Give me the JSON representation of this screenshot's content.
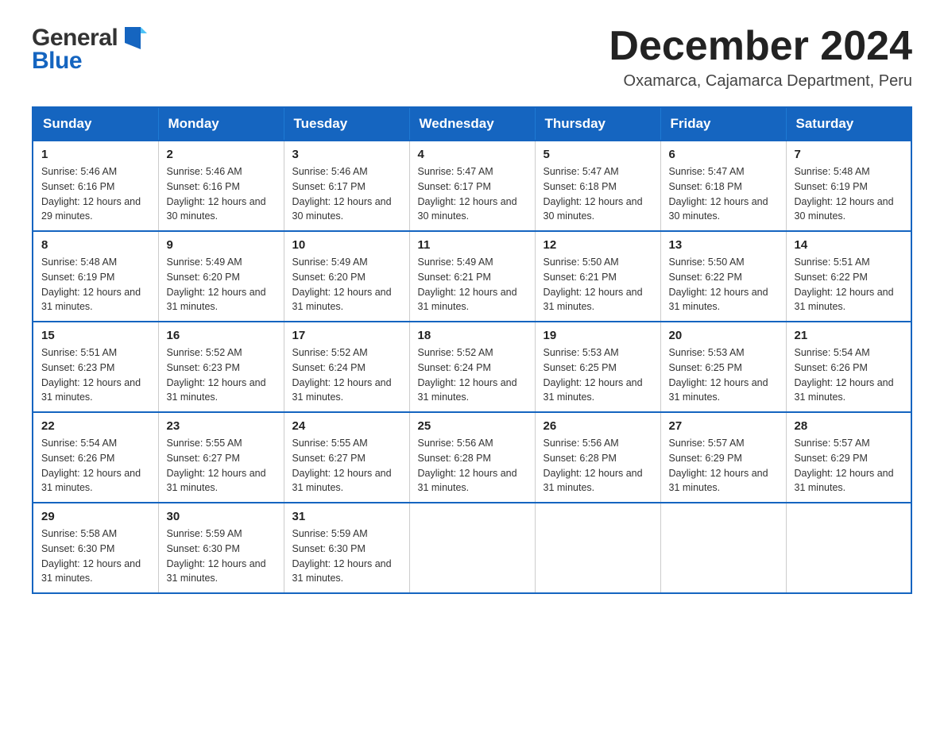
{
  "logo": {
    "part1": "General",
    "part2": "Blue"
  },
  "header": {
    "title": "December 2024",
    "subtitle": "Oxamarca, Cajamarca Department, Peru"
  },
  "days_of_week": [
    "Sunday",
    "Monday",
    "Tuesday",
    "Wednesday",
    "Thursday",
    "Friday",
    "Saturday"
  ],
  "weeks": [
    [
      {
        "day": "1",
        "sunrise": "Sunrise: 5:46 AM",
        "sunset": "Sunset: 6:16 PM",
        "daylight": "Daylight: 12 hours and 29 minutes."
      },
      {
        "day": "2",
        "sunrise": "Sunrise: 5:46 AM",
        "sunset": "Sunset: 6:16 PM",
        "daylight": "Daylight: 12 hours and 30 minutes."
      },
      {
        "day": "3",
        "sunrise": "Sunrise: 5:46 AM",
        "sunset": "Sunset: 6:17 PM",
        "daylight": "Daylight: 12 hours and 30 minutes."
      },
      {
        "day": "4",
        "sunrise": "Sunrise: 5:47 AM",
        "sunset": "Sunset: 6:17 PM",
        "daylight": "Daylight: 12 hours and 30 minutes."
      },
      {
        "day": "5",
        "sunrise": "Sunrise: 5:47 AM",
        "sunset": "Sunset: 6:18 PM",
        "daylight": "Daylight: 12 hours and 30 minutes."
      },
      {
        "day": "6",
        "sunrise": "Sunrise: 5:47 AM",
        "sunset": "Sunset: 6:18 PM",
        "daylight": "Daylight: 12 hours and 30 minutes."
      },
      {
        "day": "7",
        "sunrise": "Sunrise: 5:48 AM",
        "sunset": "Sunset: 6:19 PM",
        "daylight": "Daylight: 12 hours and 30 minutes."
      }
    ],
    [
      {
        "day": "8",
        "sunrise": "Sunrise: 5:48 AM",
        "sunset": "Sunset: 6:19 PM",
        "daylight": "Daylight: 12 hours and 31 minutes."
      },
      {
        "day": "9",
        "sunrise": "Sunrise: 5:49 AM",
        "sunset": "Sunset: 6:20 PM",
        "daylight": "Daylight: 12 hours and 31 minutes."
      },
      {
        "day": "10",
        "sunrise": "Sunrise: 5:49 AM",
        "sunset": "Sunset: 6:20 PM",
        "daylight": "Daylight: 12 hours and 31 minutes."
      },
      {
        "day": "11",
        "sunrise": "Sunrise: 5:49 AM",
        "sunset": "Sunset: 6:21 PM",
        "daylight": "Daylight: 12 hours and 31 minutes."
      },
      {
        "day": "12",
        "sunrise": "Sunrise: 5:50 AM",
        "sunset": "Sunset: 6:21 PM",
        "daylight": "Daylight: 12 hours and 31 minutes."
      },
      {
        "day": "13",
        "sunrise": "Sunrise: 5:50 AM",
        "sunset": "Sunset: 6:22 PM",
        "daylight": "Daylight: 12 hours and 31 minutes."
      },
      {
        "day": "14",
        "sunrise": "Sunrise: 5:51 AM",
        "sunset": "Sunset: 6:22 PM",
        "daylight": "Daylight: 12 hours and 31 minutes."
      }
    ],
    [
      {
        "day": "15",
        "sunrise": "Sunrise: 5:51 AM",
        "sunset": "Sunset: 6:23 PM",
        "daylight": "Daylight: 12 hours and 31 minutes."
      },
      {
        "day": "16",
        "sunrise": "Sunrise: 5:52 AM",
        "sunset": "Sunset: 6:23 PM",
        "daylight": "Daylight: 12 hours and 31 minutes."
      },
      {
        "day": "17",
        "sunrise": "Sunrise: 5:52 AM",
        "sunset": "Sunset: 6:24 PM",
        "daylight": "Daylight: 12 hours and 31 minutes."
      },
      {
        "day": "18",
        "sunrise": "Sunrise: 5:52 AM",
        "sunset": "Sunset: 6:24 PM",
        "daylight": "Daylight: 12 hours and 31 minutes."
      },
      {
        "day": "19",
        "sunrise": "Sunrise: 5:53 AM",
        "sunset": "Sunset: 6:25 PM",
        "daylight": "Daylight: 12 hours and 31 minutes."
      },
      {
        "day": "20",
        "sunrise": "Sunrise: 5:53 AM",
        "sunset": "Sunset: 6:25 PM",
        "daylight": "Daylight: 12 hours and 31 minutes."
      },
      {
        "day": "21",
        "sunrise": "Sunrise: 5:54 AM",
        "sunset": "Sunset: 6:26 PM",
        "daylight": "Daylight: 12 hours and 31 minutes."
      }
    ],
    [
      {
        "day": "22",
        "sunrise": "Sunrise: 5:54 AM",
        "sunset": "Sunset: 6:26 PM",
        "daylight": "Daylight: 12 hours and 31 minutes."
      },
      {
        "day": "23",
        "sunrise": "Sunrise: 5:55 AM",
        "sunset": "Sunset: 6:27 PM",
        "daylight": "Daylight: 12 hours and 31 minutes."
      },
      {
        "day": "24",
        "sunrise": "Sunrise: 5:55 AM",
        "sunset": "Sunset: 6:27 PM",
        "daylight": "Daylight: 12 hours and 31 minutes."
      },
      {
        "day": "25",
        "sunrise": "Sunrise: 5:56 AM",
        "sunset": "Sunset: 6:28 PM",
        "daylight": "Daylight: 12 hours and 31 minutes."
      },
      {
        "day": "26",
        "sunrise": "Sunrise: 5:56 AM",
        "sunset": "Sunset: 6:28 PM",
        "daylight": "Daylight: 12 hours and 31 minutes."
      },
      {
        "day": "27",
        "sunrise": "Sunrise: 5:57 AM",
        "sunset": "Sunset: 6:29 PM",
        "daylight": "Daylight: 12 hours and 31 minutes."
      },
      {
        "day": "28",
        "sunrise": "Sunrise: 5:57 AM",
        "sunset": "Sunset: 6:29 PM",
        "daylight": "Daylight: 12 hours and 31 minutes."
      }
    ],
    [
      {
        "day": "29",
        "sunrise": "Sunrise: 5:58 AM",
        "sunset": "Sunset: 6:30 PM",
        "daylight": "Daylight: 12 hours and 31 minutes."
      },
      {
        "day": "30",
        "sunrise": "Sunrise: 5:59 AM",
        "sunset": "Sunset: 6:30 PM",
        "daylight": "Daylight: 12 hours and 31 minutes."
      },
      {
        "day": "31",
        "sunrise": "Sunrise: 5:59 AM",
        "sunset": "Sunset: 6:30 PM",
        "daylight": "Daylight: 12 hours and 31 minutes."
      },
      null,
      null,
      null,
      null
    ]
  ]
}
